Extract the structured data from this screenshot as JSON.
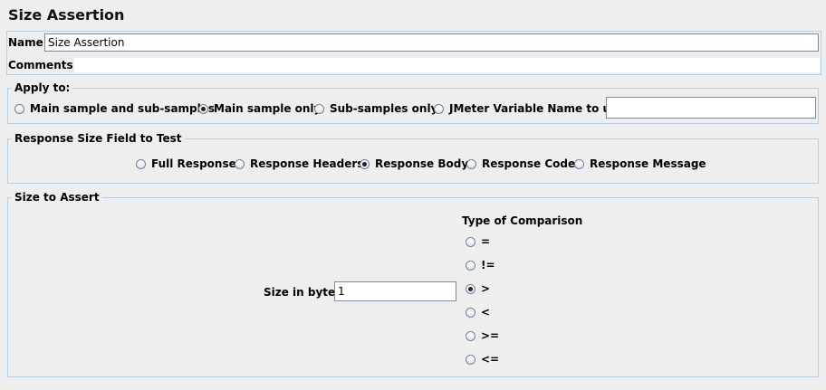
{
  "title": "Size Assertion",
  "name_field": {
    "label": "Name:",
    "value": "Size Assertion"
  },
  "comments": {
    "label": "Comments:",
    "value": ""
  },
  "apply_to": {
    "legend": "Apply to:",
    "options": [
      {
        "label": "Main sample and sub-samples",
        "selected": false
      },
      {
        "label": "Main sample only",
        "selected": true
      },
      {
        "label": "Sub-samples only",
        "selected": false
      },
      {
        "label": "JMeter Variable Name to use",
        "selected": false
      }
    ],
    "variable_value": ""
  },
  "response_field": {
    "legend": "Response Size Field to Test",
    "options": [
      {
        "label": "Full Response",
        "selected": false
      },
      {
        "label": "Response Headers",
        "selected": false
      },
      {
        "label": "Response Body",
        "selected": true
      },
      {
        "label": "Response Code",
        "selected": false
      },
      {
        "label": "Response Message",
        "selected": false
      }
    ]
  },
  "size_to_assert": {
    "legend": "Size to Assert",
    "size_label": "Size in bytes:",
    "size_value": "1",
    "comparison_heading": "Type of Comparison",
    "comparisons": [
      {
        "label": "=",
        "selected": false
      },
      {
        "label": "!=",
        "selected": false
      },
      {
        "label": ">",
        "selected": true
      },
      {
        "label": "<",
        "selected": false
      },
      {
        "label": ">=",
        "selected": false
      },
      {
        "label": "<=",
        "selected": false
      }
    ]
  }
}
